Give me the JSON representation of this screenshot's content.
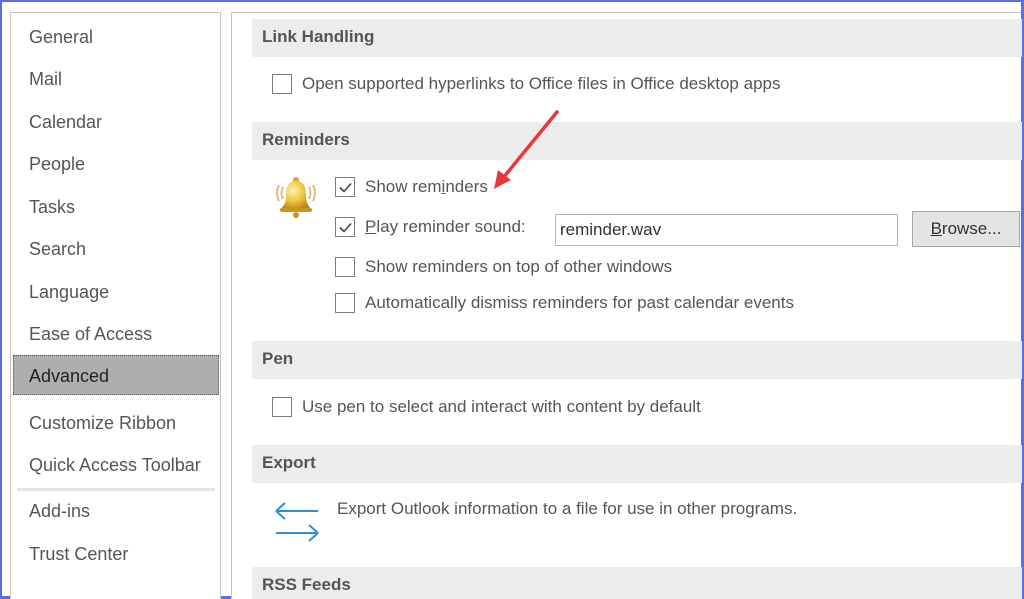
{
  "sidebar": {
    "items": [
      {
        "label": "General",
        "selected": false
      },
      {
        "label": "Mail",
        "selected": false
      },
      {
        "label": "Calendar",
        "selected": false
      },
      {
        "label": "People",
        "selected": false
      },
      {
        "label": "Tasks",
        "selected": false
      },
      {
        "label": "Search",
        "selected": false
      },
      {
        "label": "Language",
        "selected": false
      },
      {
        "label": "Ease of Access",
        "selected": false
      },
      {
        "label": "Advanced",
        "selected": true
      },
      {
        "label": "Customize Ribbon",
        "selected": false
      },
      {
        "label": "Quick Access Toolbar",
        "selected": false
      },
      {
        "label": "Add-ins",
        "selected": false
      },
      {
        "label": "Trust Center",
        "selected": false
      }
    ]
  },
  "sections": {
    "link_handling": {
      "title": "Link Handling",
      "open_hyperlinks": {
        "label": "Open supported hyperlinks to Office files in Office desktop apps",
        "checked": false
      }
    },
    "reminders": {
      "title": "Reminders",
      "icon": "bell-icon",
      "show_reminders": {
        "label_pre": "Show rem",
        "label_u": "i",
        "label_post": "nders",
        "checked": true
      },
      "play_sound": {
        "label_u": "P",
        "label_post": "lay reminder sound:",
        "checked": true,
        "value": "reminder.wav"
      },
      "browse": {
        "label_u": "B",
        "label_post": "rowse..."
      },
      "on_top": {
        "label": "Show reminders on top of other windows",
        "checked": false
      },
      "auto_dismiss": {
        "label": "Automatically dismiss reminders for past calendar events",
        "checked": false
      }
    },
    "pen": {
      "title": "Pen",
      "use_pen": {
        "label": "Use pen to select and interact with content by default",
        "checked": false
      }
    },
    "export": {
      "title": "Export",
      "icon": "export-arrows-icon",
      "description": "Export Outlook information to a file for use in other programs."
    },
    "rss": {
      "title": "RSS Feeds"
    }
  },
  "colors": {
    "frame_border": "#5b6ee8",
    "annotation_arrow": "#e8373a",
    "export_icon": "#2f8fd6",
    "selected_nav": "#aeaeae",
    "section_header_bg": "#ececec"
  }
}
